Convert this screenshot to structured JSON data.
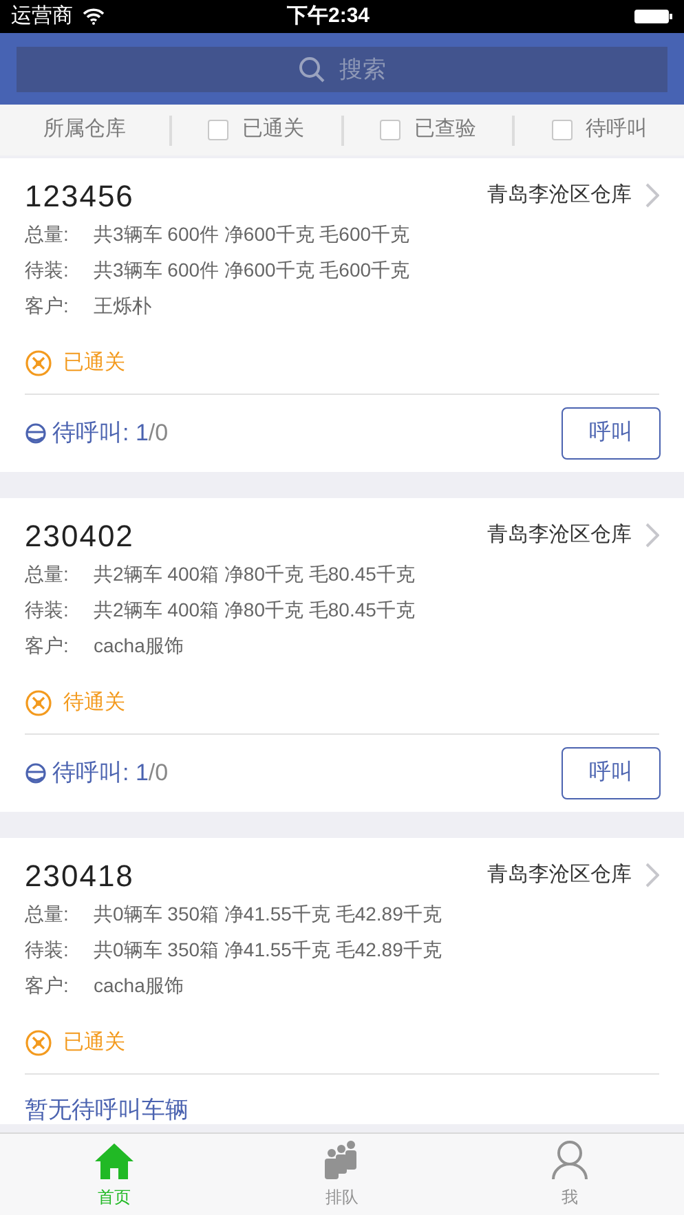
{
  "status_bar": {
    "carrier": "运营商",
    "time": "下午2:34"
  },
  "search": {
    "placeholder": "搜索"
  },
  "filters": [
    {
      "kind": "label",
      "label": "所属仓库"
    },
    {
      "kind": "checkbox",
      "label": "已通关",
      "checked": false
    },
    {
      "kind": "checkbox",
      "label": "已查验",
      "checked": false
    },
    {
      "kind": "checkbox",
      "label": "待呼叫",
      "checked": false
    }
  ],
  "orders": [
    {
      "number": "123456",
      "warehouse": "青岛李沧区仓库",
      "details": [
        {
          "label": "总量:",
          "value": "共3辆车 600件 净600千克 毛600千克"
        },
        {
          "label": "待装:",
          "value": "共3辆车 600件 净600千克 毛600千克"
        },
        {
          "label": "客户:",
          "value": "王烁朴"
        }
      ],
      "customs": "已通关",
      "call": {
        "kind": "queue",
        "label": "待呼叫:",
        "count": "1",
        "total": "/0",
        "button": "呼叫"
      }
    },
    {
      "number": "230402",
      "warehouse": "青岛李沧区仓库",
      "details": [
        {
          "label": "总量:",
          "value": "共2辆车 400箱 净80千克 毛80.45千克"
        },
        {
          "label": "待装:",
          "value": "共2辆车 400箱 净80千克 毛80.45千克"
        },
        {
          "label": "客户:",
          "value": "cacha服饰"
        }
      ],
      "customs": "待通关",
      "call": {
        "kind": "queue",
        "label": "待呼叫:",
        "count": "1",
        "total": "/0",
        "button": "呼叫"
      }
    },
    {
      "number": "230418",
      "warehouse": "青岛李沧区仓库",
      "details": [
        {
          "label": "总量:",
          "value": "共0辆车 350箱 净41.55千克 毛42.89千克"
        },
        {
          "label": "待装:",
          "value": "共0辆车 350箱 净41.55千克 毛42.89千克"
        },
        {
          "label": "客户:",
          "value": "cacha服饰"
        }
      ],
      "customs": "已通关",
      "call": {
        "kind": "none",
        "message": "暂无待呼叫车辆"
      }
    }
  ],
  "tab_bar": [
    {
      "label": "首页",
      "kind": "home",
      "selected": true
    },
    {
      "label": "排队",
      "kind": "queue",
      "selected": false
    },
    {
      "label": "我",
      "kind": "person",
      "selected": false
    }
  ]
}
